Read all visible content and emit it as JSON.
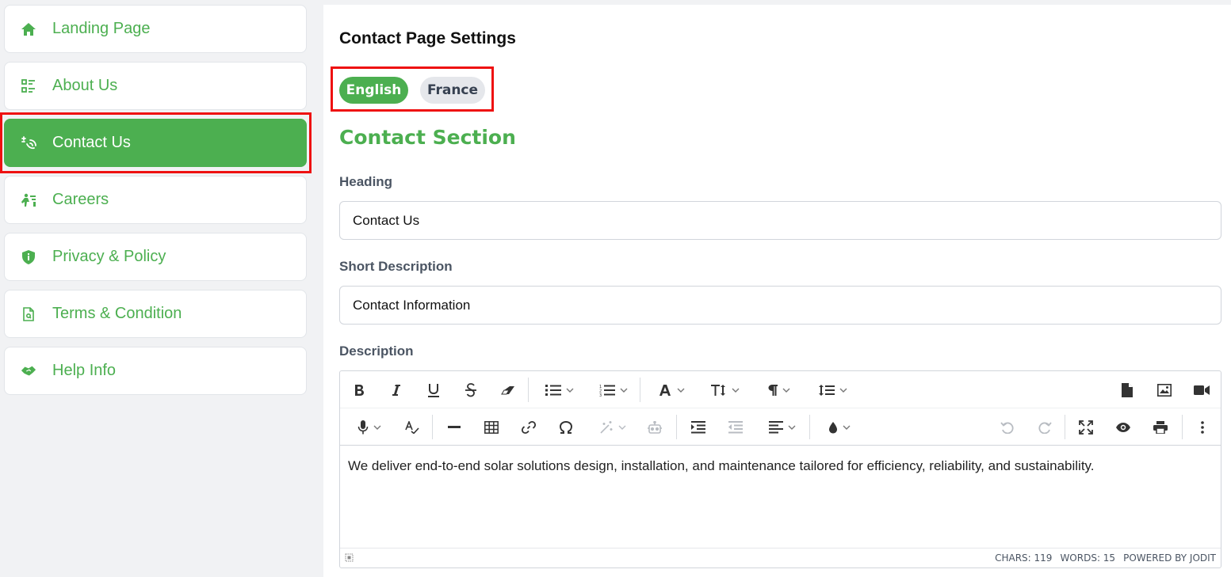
{
  "sidebar": {
    "items": [
      {
        "label": "Landing Page",
        "icon": "home-icon",
        "active": false
      },
      {
        "label": "About Us",
        "icon": "list-details-icon",
        "active": false
      },
      {
        "label": "Contact Us",
        "icon": "contact-icon",
        "active": true
      },
      {
        "label": "Careers",
        "icon": "career-icon",
        "active": false
      },
      {
        "label": "Privacy & Policy",
        "icon": "shield-icon",
        "active": false
      },
      {
        "label": "Terms & Condition",
        "icon": "document-icon",
        "active": false
      },
      {
        "label": "Help Info",
        "icon": "handshake-icon",
        "active": false
      }
    ]
  },
  "main": {
    "title": "Contact Page Settings",
    "languages": [
      "English",
      "France"
    ],
    "selected_language": "English",
    "section_title": "Contact Section",
    "heading": {
      "label": "Heading",
      "value": "Contact Us"
    },
    "short_description": {
      "label": "Short Description",
      "value": "Contact Information"
    },
    "description": {
      "label": "Description",
      "content": "We deliver end-to-end solar solutions design, installation, and maintenance tailored for efficiency, reliability, and sustainability.",
      "chars": "CHARS: 119",
      "words": "WORDS: 15",
      "powered_by": "POWERED BY JODIT"
    }
  },
  "colors": {
    "accent": "#4caf50",
    "highlight": "#ee1111",
    "inactive_pill": "#e5e7eb"
  }
}
